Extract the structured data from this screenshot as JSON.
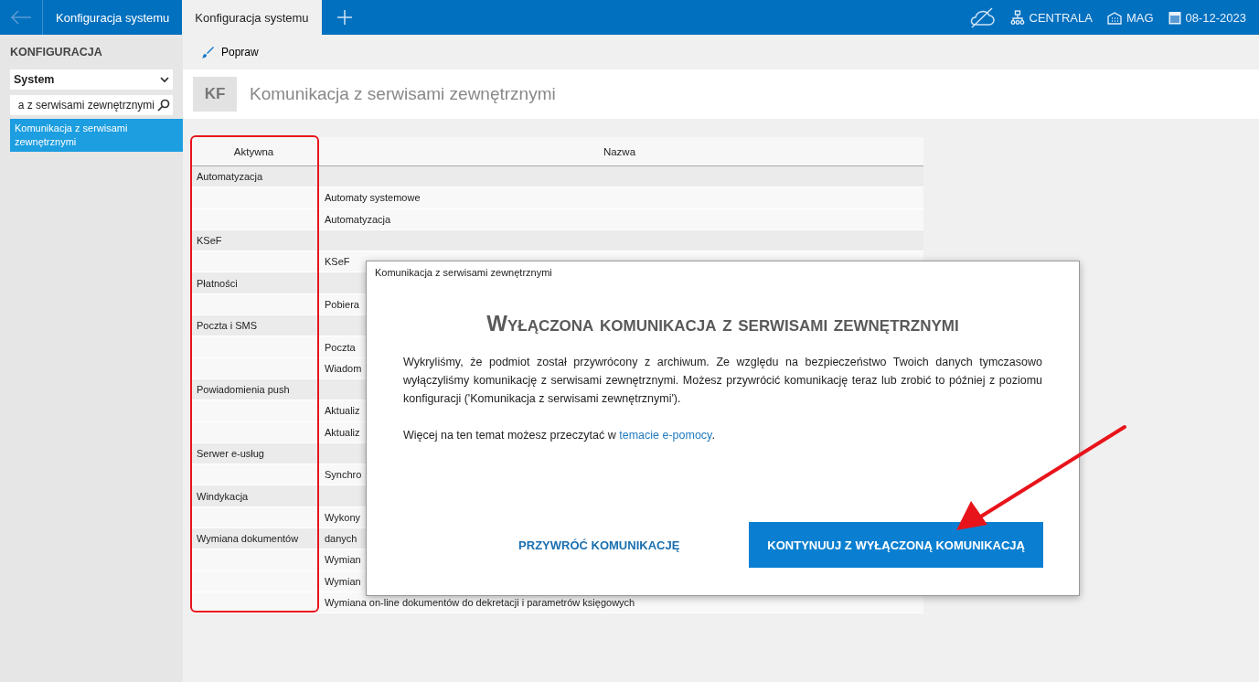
{
  "topbar": {
    "tabs": [
      {
        "label": "Konfiguracja systemu",
        "selected": false
      },
      {
        "label": "Konfiguracja systemu",
        "selected": true
      }
    ],
    "status": [
      {
        "kind": "cloud"
      },
      {
        "kind": "network",
        "label": "CENTRALA"
      },
      {
        "kind": "building",
        "label": "MAG"
      },
      {
        "kind": "calendar",
        "label": "08-12-2023"
      }
    ]
  },
  "sidebar": {
    "title": "KONFIGURACJA",
    "select": "System",
    "search": "a z serwisami zewnętrznymi",
    "items": [
      {
        "label": "Komunikacja z serwisami zewnętrznymi",
        "selected": true
      }
    ]
  },
  "toolbar": {
    "buttons": [
      "Popraw"
    ]
  },
  "header": {
    "badge": "KF",
    "title": "Komunikacja z serwisami zewnętrznymi"
  },
  "table": {
    "columns": [
      "Aktywna",
      "Nazwa"
    ],
    "rows": [
      {
        "kind": "group",
        "group": "Automatyzacja"
      },
      {
        "kind": "item",
        "name": "Automaty systemowe"
      },
      {
        "kind": "item",
        "name": "Automatyzacja"
      },
      {
        "kind": "group",
        "group": "KSeF"
      },
      {
        "kind": "item",
        "name": "KSeF"
      },
      {
        "kind": "group",
        "group": "Płatności"
      },
      {
        "kind": "item",
        "name": "Pobiera"
      },
      {
        "kind": "group",
        "group": "Poczta i SMS"
      },
      {
        "kind": "item",
        "name": "Poczta"
      },
      {
        "kind": "item",
        "name": "Wiadom"
      },
      {
        "kind": "group",
        "group": "Powiadomienia push"
      },
      {
        "kind": "item",
        "name": "Aktualiz"
      },
      {
        "kind": "item",
        "name": "Aktualiz"
      },
      {
        "kind": "group",
        "group": "Serwer e-usług"
      },
      {
        "kind": "item",
        "name": "Synchro"
      },
      {
        "kind": "group",
        "group": "Windykacja"
      },
      {
        "kind": "item",
        "name": "Wykony"
      },
      {
        "kind": "group",
        "group": "Wymiana dokumentów",
        "name": "danych"
      },
      {
        "kind": "item",
        "name": "Wymian"
      },
      {
        "kind": "item",
        "name": "Wymian"
      },
      {
        "kind": "item",
        "name": "Wymiana on-line dokumentów do dekretacji i parametrów księgowych"
      }
    ]
  },
  "dialog": {
    "title": "Komunikacja z serwisami zewnętrznymi",
    "heading": "Wyłączona komunikacja z serwisami zewnętrznymi",
    "body": "Wykryliśmy, że podmiot został przywrócony z archiwum. Ze względu na bezpieczeństwo Twoich danych tymczasowo wyłączyliśmy komunikację z serwisami zewnętrznymi. Możesz przywrócić komunikację teraz lub zrobić to później z poziomu konfiguracji ('Komunikacja z serwisami zewnętrznymi').",
    "more": "Więcej na ten temat możesz przeczytać w",
    "link": "temacie e-pomocy",
    "more_end": ".",
    "buttons": [
      {
        "label": "PRZYWRÓĆ KOMUNIKACJĘ",
        "kind": "secondary"
      },
      {
        "label": "KONTYNUUJ Z WYŁĄCZONĄ KOMUNIKACJĄ",
        "kind": "primary"
      }
    ]
  }
}
